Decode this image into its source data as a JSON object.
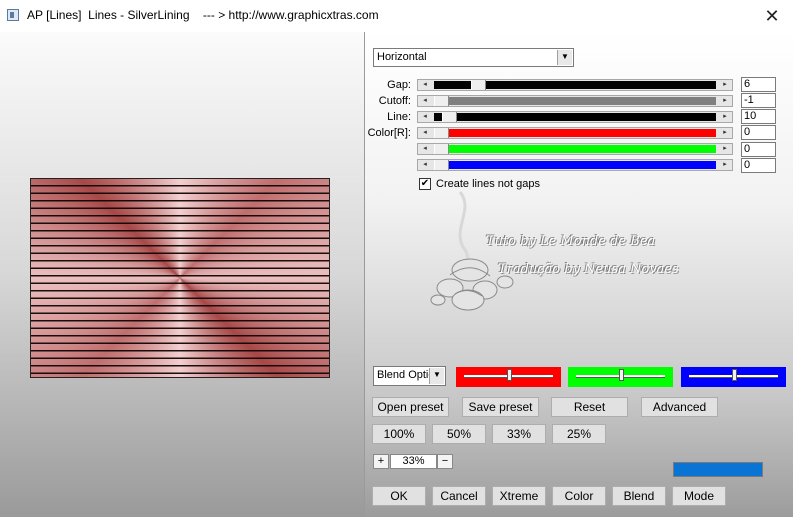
{
  "window": {
    "title": "AP [Lines]  Lines - SilverLining    --- > http://www.graphicxtras.com",
    "close_glyph": "✕"
  },
  "direction_select": {
    "value": "Horizontal"
  },
  "sliders": [
    {
      "label": "Gap:",
      "value": "6",
      "fill_color": "#000000",
      "thumb_fraction": 0.14
    },
    {
      "label": "Cutoff:",
      "value": "-1",
      "fill_color": "#808080",
      "thumb_fraction": 0.0
    },
    {
      "label": "Line:",
      "value": "10",
      "fill_color": "#000000",
      "thumb_fraction": 0.03
    },
    {
      "label": "Color[R]:",
      "value": "0",
      "fill_color": "#ff0000",
      "thumb_fraction": 0.0
    },
    {
      "label": "",
      "value": "0",
      "fill_color": "#00ff00",
      "thumb_fraction": 0.0
    },
    {
      "label": "",
      "value": "0",
      "fill_color": "#0000ff",
      "thumb_fraction": 0.0
    }
  ],
  "checkbox": {
    "label": "Create lines not gaps",
    "checked": true,
    "glyph": "✔"
  },
  "watermark": {
    "line1": "Tuto by  Le Monde de Bea",
    "line2": "Tradução by  Neusa Novaes"
  },
  "blend_select": {
    "value": "Blend Optio"
  },
  "color_bars": [
    {
      "color": "#ff0000",
      "level": 0.5
    },
    {
      "color": "#00ff00",
      "level": 0.5
    },
    {
      "color": "#0000ff",
      "level": 0.5
    }
  ],
  "preset_buttons": [
    "Open preset",
    "Save preset",
    "Reset",
    "Advanced"
  ],
  "zoom_buttons": [
    "100%",
    "50%",
    "33%",
    "25%"
  ],
  "zoom": {
    "minus": "−",
    "plus": "+",
    "value": "33%"
  },
  "bottom_buttons": [
    "OK",
    "Cancel",
    "Xtreme",
    "Color",
    "Blend",
    "Mode"
  ],
  "swatch_color": "#0a74d4",
  "arrow_glyphs": {
    "left": "◂",
    "right": "▸",
    "down": "▼"
  }
}
